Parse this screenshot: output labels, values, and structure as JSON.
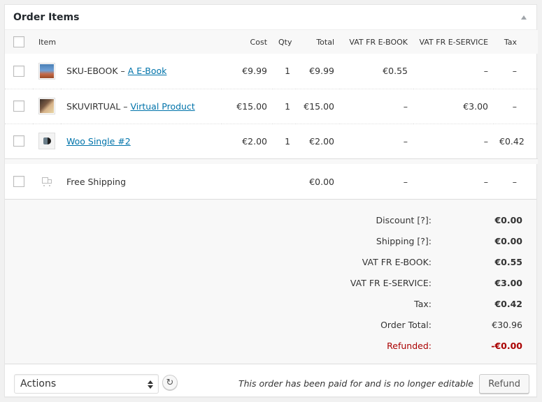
{
  "panel": {
    "title": "Order Items",
    "toggle_icon": "triangle-up-icon"
  },
  "table": {
    "headers": {
      "item": "Item",
      "cost": "Cost",
      "qty": "Qty",
      "total": "Total",
      "vat_ebook": "VAT FR E-BOOK",
      "vat_eservice": "VAT FR E-SERVICE",
      "tax": "Tax"
    },
    "rows": [
      {
        "sku": "SKU-EBOOK – ",
        "name": "A E-Book",
        "cost": "€9.99",
        "qty": "1",
        "total": "€9.99",
        "vat_ebook": "€0.55",
        "vat_eservice": "–",
        "tax": "–"
      },
      {
        "sku": "SKUVIRTUAL – ",
        "name": "Virtual Product",
        "cost": "€15.00",
        "qty": "1",
        "total": "€15.00",
        "vat_ebook": "–",
        "vat_eservice": "€3.00",
        "tax": "–"
      },
      {
        "sku": "",
        "name": "Woo Single #2",
        "cost": "€2.00",
        "qty": "1",
        "total": "€2.00",
        "vat_ebook": "–",
        "vat_eservice": "–",
        "tax": "€0.42"
      }
    ],
    "shipping": {
      "name": "Free Shipping",
      "total": "€0.00",
      "vat_ebook": "–",
      "vat_eservice": "–",
      "tax": "–",
      "icon": "shipping-truck-icon"
    }
  },
  "totals": [
    {
      "label": "Discount [?]:",
      "value": "€0.00"
    },
    {
      "label": "Shipping [?]:",
      "value": "€0.00"
    },
    {
      "label": "VAT FR E-BOOK:",
      "value": "€0.55"
    },
    {
      "label": "VAT FR E-SERVICE:",
      "value": "€3.00"
    },
    {
      "label": "Tax:",
      "value": "€0.42"
    },
    {
      "label": "Order Total:",
      "value": "€30.96"
    },
    {
      "label": "Refunded:",
      "value": "-€0.00"
    }
  ],
  "footer": {
    "actions_select": "Actions",
    "reload_icon": "↻",
    "paid_note": "This order has been paid for and is no longer editable",
    "refund_button": "Refund"
  },
  "colors": {
    "link": "#0073aa",
    "refund": "#aa0000"
  }
}
